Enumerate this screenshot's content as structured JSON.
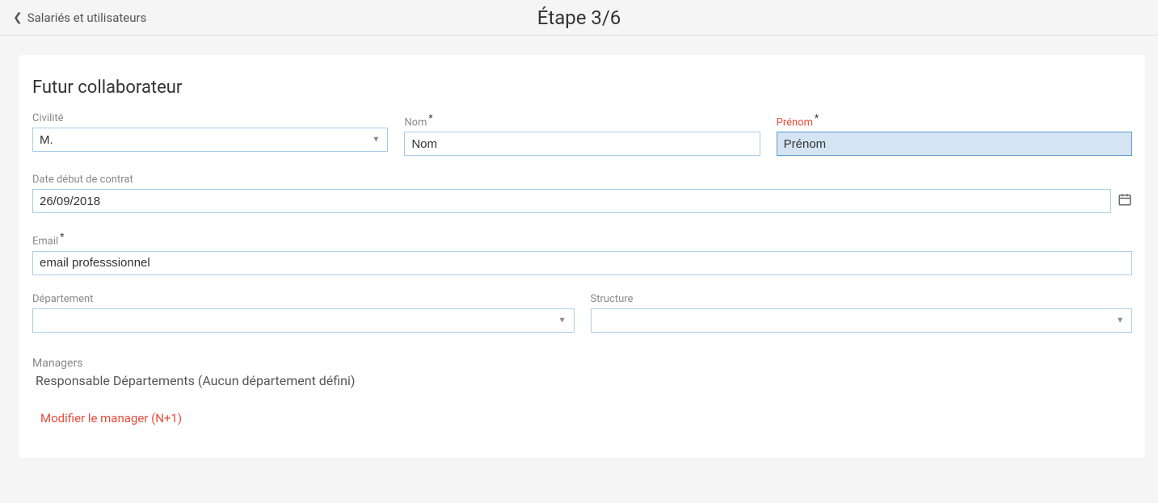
{
  "header": {
    "back_label": "Salariés et utilisateurs",
    "step_title": "Étape 3/6"
  },
  "form": {
    "section_title": "Futur collaborateur",
    "civility": {
      "label": "Civilité",
      "value": "M."
    },
    "lastname": {
      "label": "Nom",
      "value": "Nom"
    },
    "firstname": {
      "label": "Prénom",
      "value": "Prénom"
    },
    "contract_start": {
      "label": "Date début de contrat",
      "value": "26/09/2018"
    },
    "email": {
      "label": "Email",
      "value": "email professsionnel"
    },
    "department": {
      "label": "Département",
      "value": ""
    },
    "structure": {
      "label": "Structure",
      "value": ""
    },
    "managers": {
      "label": "Managers",
      "value": "Responsable Départements (Aucun département défini)",
      "modify_link": "Modifier le manager (N+1)"
    }
  }
}
